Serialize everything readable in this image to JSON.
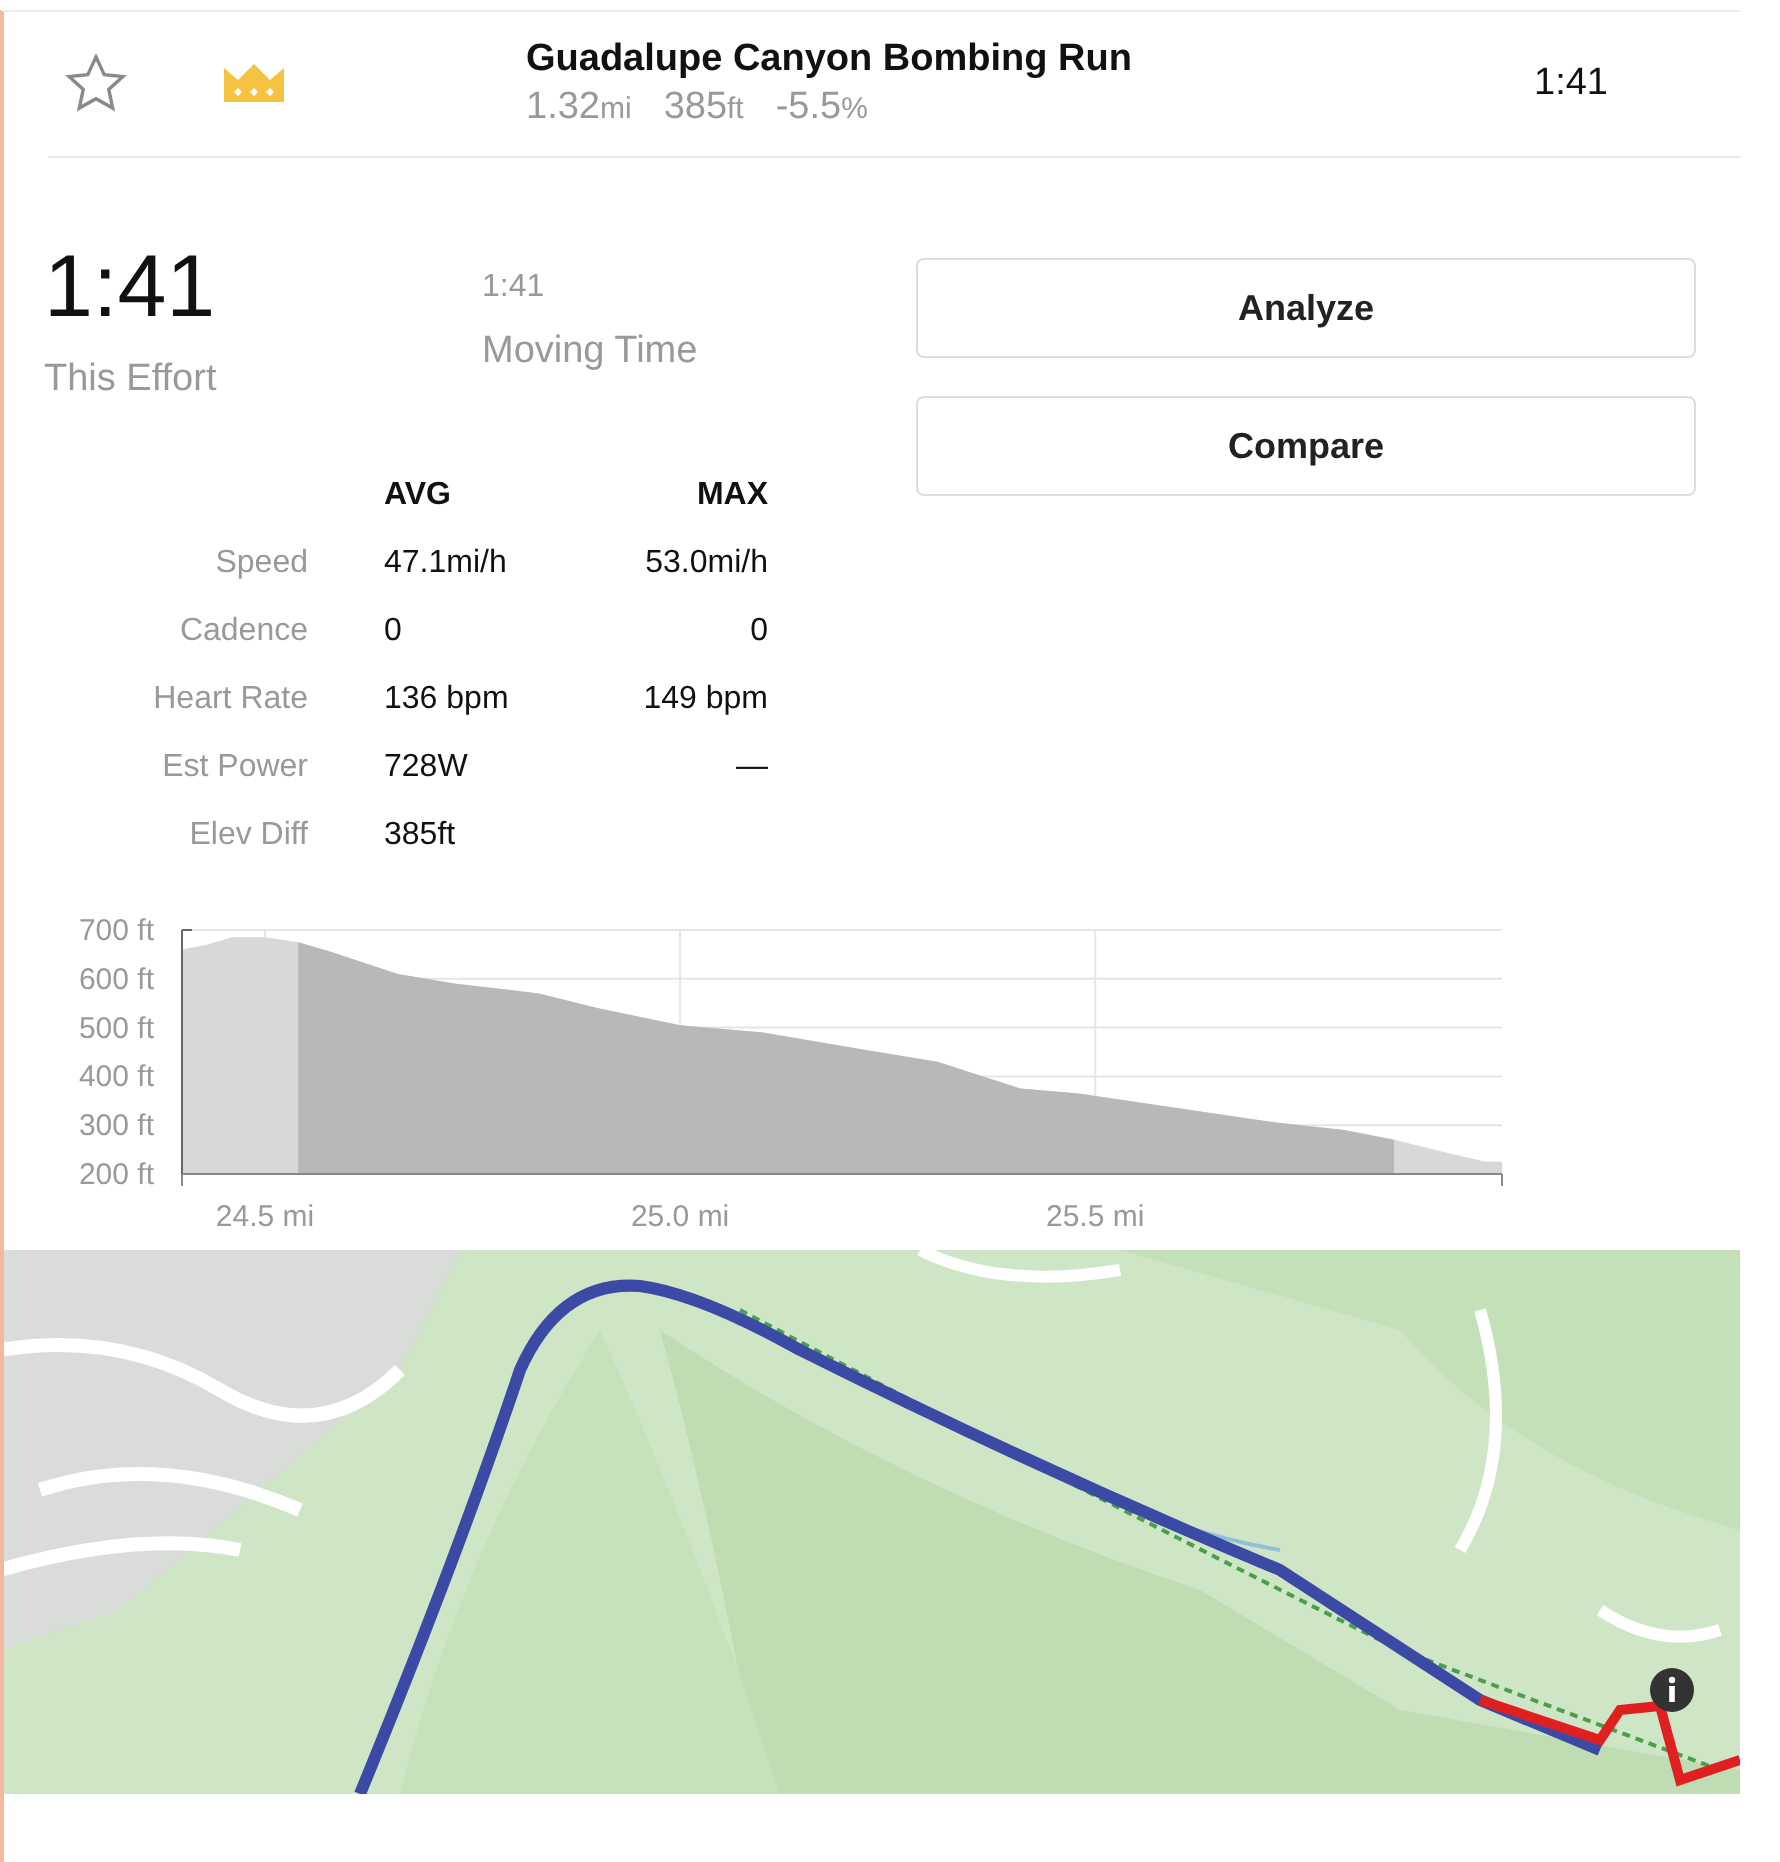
{
  "segment": {
    "starred": false,
    "title": "Guadalupe Canyon Bombing Run",
    "metrics": [
      {
        "value": "1.32",
        "unit": "mi"
      },
      {
        "value": "385",
        "unit": "ft"
      },
      {
        "value": "-5.5",
        "unit": "%"
      }
    ],
    "time": "1:41"
  },
  "effort": {
    "time": "1:41",
    "label": "This Effort"
  },
  "moving": {
    "time": "1:41",
    "label": "Moving Time"
  },
  "buttons": [
    "Analyze",
    "Compare"
  ],
  "stats": {
    "columns": [
      "AVG",
      "MAX"
    ],
    "rows": [
      {
        "label": "Speed",
        "avg": "47.1mi/h",
        "max": "53.0mi/h"
      },
      {
        "label": "Cadence",
        "avg": "0",
        "max": "0"
      },
      {
        "label": "Heart Rate",
        "avg": "136 bpm",
        "max": "149 bpm"
      },
      {
        "label": "Est Power",
        "avg": "728W",
        "max": "—"
      },
      {
        "label": "Elev Diff",
        "avg": "385ft"
      }
    ]
  },
  "elevation": {
    "chart_data": {
      "type": "area",
      "grid": true,
      "xlim": [
        24.4,
        25.99
      ],
      "ylim": [
        200,
        700
      ],
      "xticks": [
        {
          "value": 24.5,
          "label": "24.5 mi"
        },
        {
          "value": 25.0,
          "label": "25.0 mi"
        },
        {
          "value": 25.5,
          "label": "25.5 mi"
        }
      ],
      "yticks": [
        {
          "value": 700,
          "label": "700 ft"
        },
        {
          "value": 600,
          "label": "600 ft"
        },
        {
          "value": 500,
          "label": "500 ft"
        },
        {
          "value": 400,
          "label": "400 ft"
        },
        {
          "value": 300,
          "label": "300 ft"
        },
        {
          "value": 200,
          "label": "200 ft"
        }
      ],
      "x": [
        24.4,
        24.43,
        24.46,
        24.5,
        24.54,
        24.58,
        24.66,
        24.73,
        24.83,
        24.9,
        25.0,
        25.1,
        25.22,
        25.31,
        25.41,
        25.48,
        25.58,
        25.72,
        25.8,
        25.86,
        25.92,
        25.97,
        25.99
      ],
      "series": [
        {
          "color": "#d8d8d8",
          "values": [
            660,
            670,
            685,
            685,
            675,
            655,
            610,
            590,
            570,
            540,
            505,
            490,
            455,
            430,
            375,
            365,
            340,
            305,
            290,
            270,
            245,
            225,
            225
          ]
        },
        {
          "color": "#b8b8b8",
          "values": [
            null,
            null,
            null,
            null,
            675,
            655,
            610,
            590,
            570,
            540,
            505,
            490,
            455,
            430,
            375,
            365,
            340,
            305,
            290,
            270,
            null,
            null,
            null
          ]
        }
      ]
    }
  },
  "map": {
    "kind": "picture"
  }
}
